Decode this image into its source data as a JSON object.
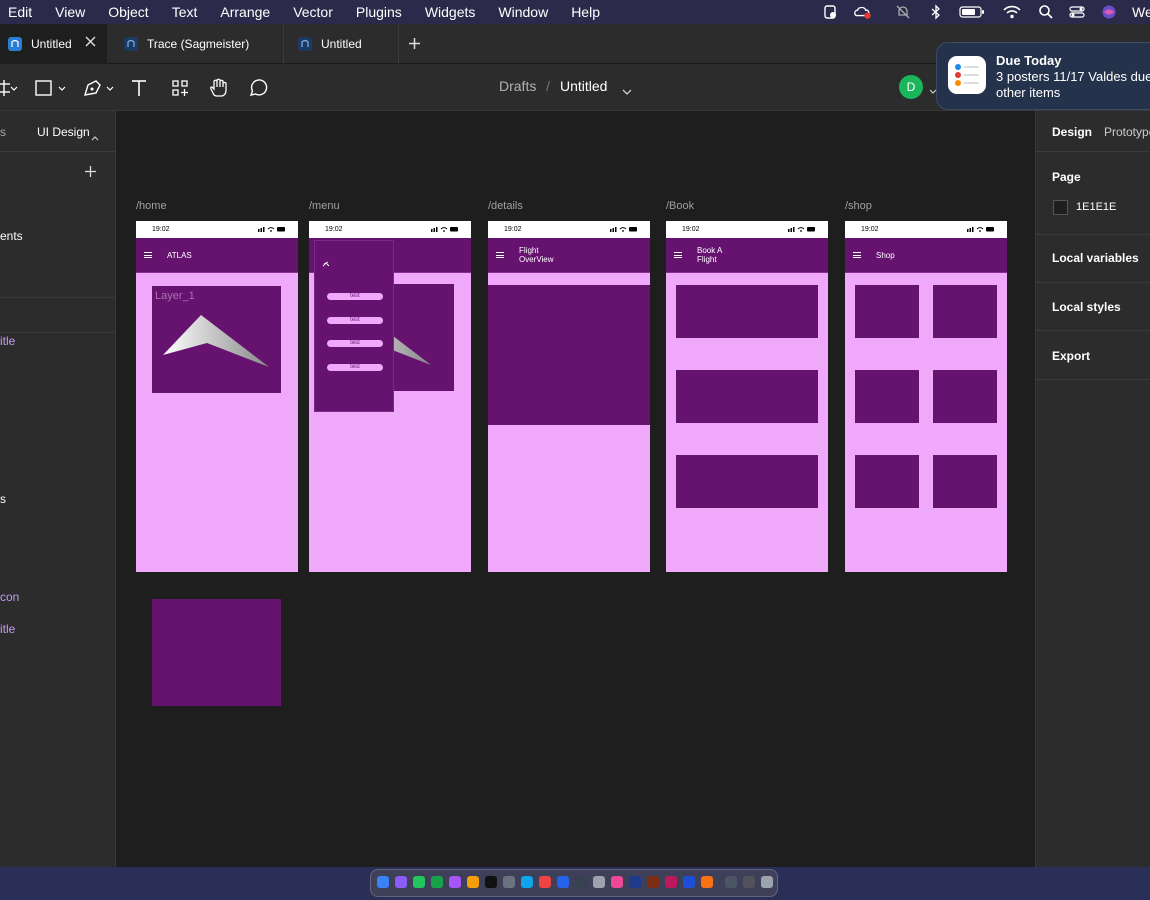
{
  "menubar": {
    "items": [
      "Edit",
      "View",
      "Object",
      "Text",
      "Arrange",
      "Vector",
      "Plugins",
      "Widgets",
      "Window",
      "Help"
    ],
    "right_text": "We"
  },
  "tabs": [
    {
      "label": "Untitled",
      "active": true
    },
    {
      "label": "Trace (Sagmeister)",
      "active": false
    },
    {
      "label": "Untitled",
      "active": false
    }
  ],
  "toolbar": {
    "breadcrumb_parent": "Drafts",
    "breadcrumb_separator": "/",
    "file_name": "Untitled",
    "avatar_letter": "D"
  },
  "notification": {
    "title": "Due Today",
    "line1": "3 posters 11/17 Valdes due",
    "line2": "other items"
  },
  "left_panel": {
    "pages_tab_fragment": "s",
    "section_label": "UI Design",
    "layer_fragments": [
      "ents",
      "itle",
      "s",
      "con",
      "itle"
    ]
  },
  "right_panel": {
    "tabs": [
      "Design",
      "Prototype"
    ],
    "page_heading": "Page",
    "page_color": "1E1E1E",
    "sections": [
      "Local variables",
      "Local styles",
      "Export"
    ]
  },
  "canvas": {
    "frames": [
      {
        "label": "/home",
        "time": "19:02",
        "title_lines": [
          "ATLAS"
        ],
        "layer_label": "Layer_1"
      },
      {
        "label": "/menu",
        "time": "19:02",
        "title_lines": [],
        "menu_items": [
          "test",
          "test",
          "test",
          "test"
        ]
      },
      {
        "label": "/details",
        "time": "19:02",
        "title_lines": [
          "Flight",
          "OverView"
        ]
      },
      {
        "label": "/Book",
        "time": "19:02",
        "title_lines": [
          "Book A",
          "Flight"
        ]
      },
      {
        "label": "/shop",
        "time": "19:02",
        "title_lines": [
          "Shop"
        ]
      }
    ],
    "background_color": "#1e1e1e",
    "frame_bg_color": "#f0a8fb",
    "block_color": "#661370"
  }
}
